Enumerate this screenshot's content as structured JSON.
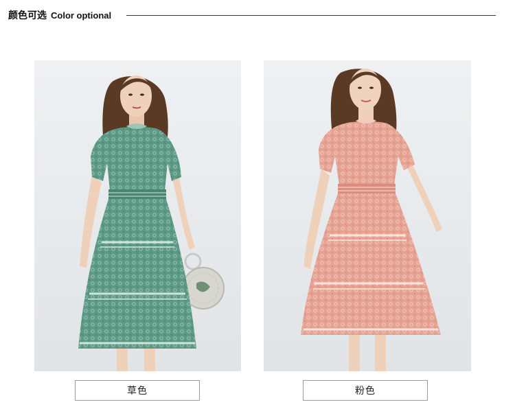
{
  "header": {
    "title_cn": "颜色可选",
    "title_en": "Color optional"
  },
  "products": [
    {
      "color_label": "草色",
      "dress_color": "#5d9a86",
      "dress_shadow": "#3f7664",
      "dress_light": "#9cc7b6",
      "accessory": "round-beaded-bag"
    },
    {
      "color_label": "粉色",
      "dress_color": "#e6a394",
      "dress_shadow": "#c9806f",
      "dress_light": "#f5cbc0"
    }
  ]
}
